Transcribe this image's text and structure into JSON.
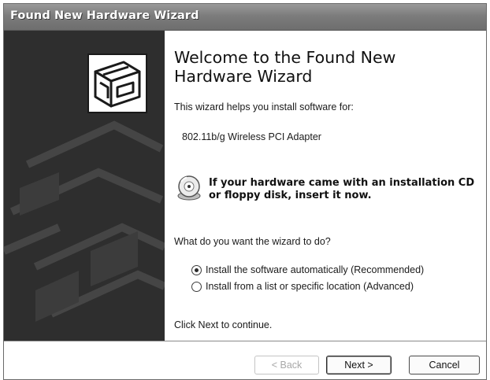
{
  "window": {
    "title": "Found New Hardware Wizard"
  },
  "content": {
    "heading": "Welcome to the Found New Hardware Wizard",
    "intro": "This wizard helps you install software for:",
    "device_name": "802.11b/g Wireless PCI Adapter",
    "cd_note_line1": "If your hardware came with an installation CD",
    "cd_note_line2": "or floppy disk, insert it now.",
    "question": "What do you want the wizard to do?",
    "options": [
      {
        "label": "Install the software automatically (Recommended)",
        "selected": true
      },
      {
        "label": "Install from a list or specific location (Advanced)",
        "selected": false
      }
    ],
    "footer": "Click Next to continue."
  },
  "buttons": {
    "back": {
      "label": "< Back",
      "enabled": false
    },
    "next": {
      "label": "Next >",
      "enabled": true
    },
    "cancel": {
      "label": "Cancel",
      "enabled": true
    }
  },
  "icons": {
    "wizard": "hardware-box-icon",
    "cd": "cd-disk-icon"
  }
}
